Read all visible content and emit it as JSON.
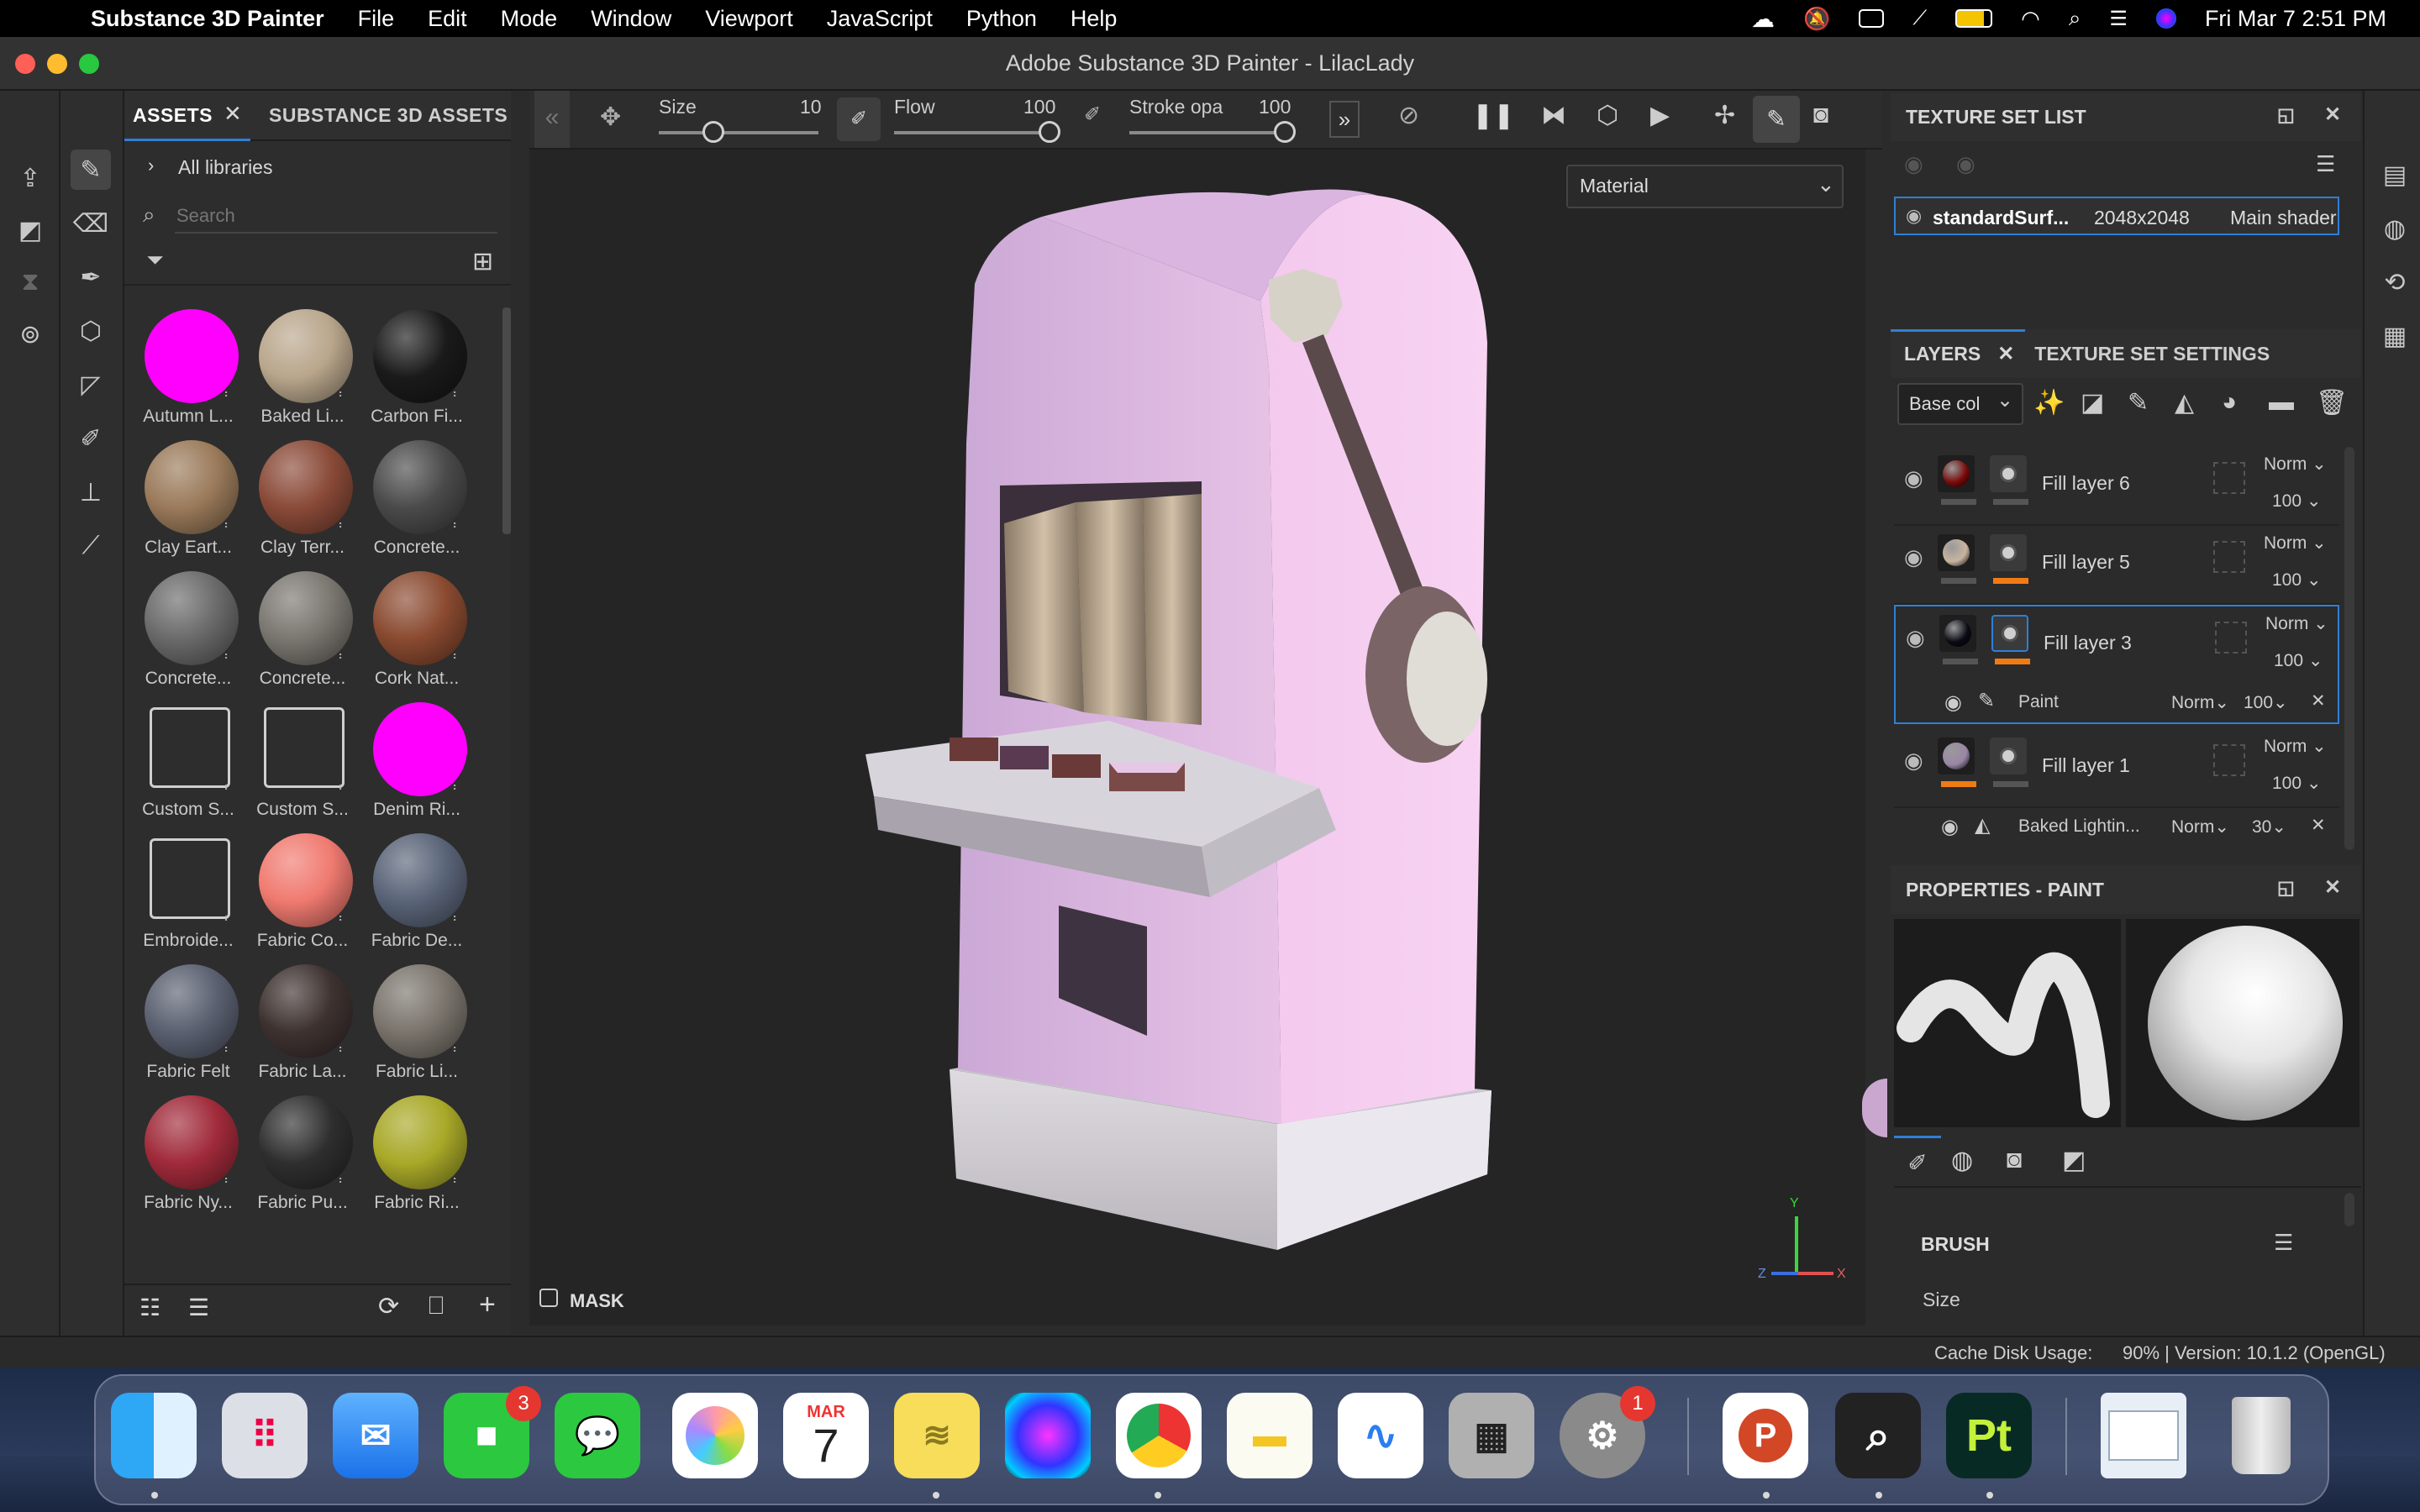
{
  "menubar": {
    "app_name": "Substance 3D Painter",
    "items": [
      "File",
      "Edit",
      "Mode",
      "Window",
      "Viewport",
      "JavaScript",
      "Python",
      "Help"
    ],
    "clock": "Fri Mar 7  2:51 PM"
  },
  "window": {
    "title": "Adobe Substance 3D Painter - LilacLady"
  },
  "assets": {
    "tab_assets": "ASSETS",
    "tab_substance": "SUBSTANCE 3D ASSETS",
    "library": "All libraries",
    "search_placeholder": "Search",
    "items": [
      {
        "label": "Autumn L...",
        "color": "#ff00ff"
      },
      {
        "label": "Baked Li...",
        "color": "#b9a68c"
      },
      {
        "label": "Carbon Fi...",
        "color": "#1a1a1a"
      },
      {
        "label": "Clay Eart...",
        "color": "#9a7a5a"
      },
      {
        "label": "Clay Terr...",
        "color": "#8a4a38"
      },
      {
        "label": "Concrete...",
        "color": "#4a4a4a"
      },
      {
        "label": "Concrete...",
        "color": "#6a6a6a"
      },
      {
        "label": "Concrete...",
        "color": "#7a7670"
      },
      {
        "label": "Cork Nat...",
        "color": "#8a4a30"
      },
      {
        "label": "Custom S...",
        "color": "icon"
      },
      {
        "label": "Custom S...",
        "color": "icon"
      },
      {
        "label": "Denim Ri...",
        "color": "#ff00ff"
      },
      {
        "label": "Embroide...",
        "color": "icon"
      },
      {
        "label": "Fabric Co...",
        "color": "#f07a70"
      },
      {
        "label": "Fabric De...",
        "color": "#5a6478"
      },
      {
        "label": "Fabric Felt",
        "color": "#5a6070"
      },
      {
        "label": "Fabric La...",
        "color": "#3e3230"
      },
      {
        "label": "Fabric Li...",
        "color": "#7a746c"
      },
      {
        "label": "Fabric Ny...",
        "color": "#a02a3a"
      },
      {
        "label": "Fabric Pu...",
        "color": "#2e2e2e"
      },
      {
        "label": "Fabric Ri...",
        "color": "#a8a828"
      }
    ]
  },
  "toolbar": {
    "size_label": "Size",
    "size_value": "10",
    "flow_label": "Flow",
    "flow_value": "100",
    "stroke_label": "Stroke opa",
    "stroke_value": "100"
  },
  "viewport": {
    "material_select": "Material",
    "mask_label": "MASK"
  },
  "texture_set_list": {
    "header": "TEXTURE SET LIST",
    "set_name": "standardSurf...",
    "resolution": "2048x2048",
    "shader": "Main shader"
  },
  "layers": {
    "tab_layers": "LAYERS",
    "tab_tss": "TEXTURE SET SETTINGS",
    "channel": "Base col",
    "rows": [
      {
        "name": "Fill layer 6",
        "blend": "Norm",
        "opacity": "100",
        "thumb": "#7a0a0a"
      },
      {
        "name": "Fill layer 5",
        "blend": "Norm",
        "opacity": "100",
        "thumb": "#c8b4a0"
      },
      {
        "name": "Fill layer 3",
        "blend": "Norm",
        "opacity": "100",
        "thumb": "#0a0a14"
      },
      {
        "name": "Fill layer 1",
        "blend": "Norm",
        "opacity": "100",
        "thumb": "#9a86a6"
      }
    ],
    "sub_paint": {
      "name": "Paint",
      "blend": "Norm",
      "opacity": "100"
    },
    "sub_baked": {
      "name": "Baked Lightin...",
      "blend": "Norm",
      "opacity": "30"
    }
  },
  "properties": {
    "header": "PROPERTIES - PAINT",
    "brush_label": "BRUSH",
    "size_label": "Size"
  },
  "status": {
    "cache_label": "Cache Disk Usage:",
    "cache_value": "90% | Version: 10.1.2 (OpenGL)"
  },
  "dock": {
    "calendar_month": "MAR",
    "calendar_day": "7",
    "facetime_badge": "3",
    "settings_badge": "1",
    "painter_label": "Pt",
    "ppt_label": "P"
  },
  "gizmo": {
    "y": "Y",
    "z": "Z",
    "x": "X"
  }
}
